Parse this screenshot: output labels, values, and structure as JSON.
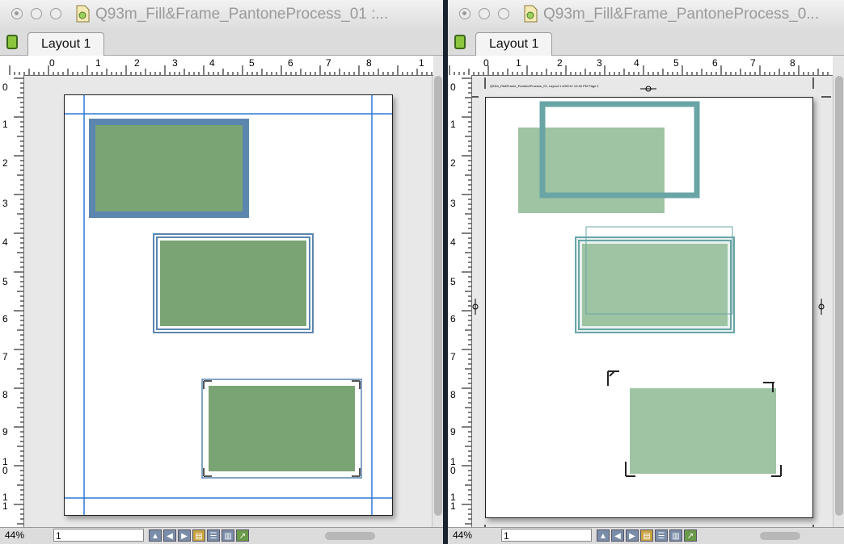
{
  "windows": {
    "left": {
      "title": "Q93m_Fill&Frame_PantoneProcess_01 :...",
      "tab_label": "Layout 1",
      "zoom": "44%",
      "page_number": "1"
    },
    "right": {
      "title": "Q93m_Fill&Frame_PantoneProcess_0...",
      "tab_label": "Layout 1",
      "zoom": "44%",
      "page_number": "1",
      "slug_text": "Q93m_Fill&Frame_PantoneProcess_01, Layout 1   6/02/12   12:46 PM   Page 1"
    }
  },
  "ruler": {
    "h_labels": [
      "0",
      "1",
      "2",
      "3",
      "4",
      "5",
      "6",
      "7",
      "8",
      "1"
    ],
    "v_labels": [
      "0",
      "1",
      "2",
      "3",
      "4",
      "5",
      "6",
      "7",
      "8",
      "9",
      "1\n0",
      "1\n1"
    ]
  },
  "colors": {
    "fill_green_left": "#7aa474",
    "frame_blue_left": "#5b86b0",
    "fill_green_right": "#9ec4a3",
    "frame_teal_right": "#6aa5a6",
    "guide_blue": "#2f79d6"
  },
  "icons": {
    "close": "circle-button-icon",
    "minimize": "circle-button-icon",
    "zoom": "circle-button-icon",
    "document": "qxp-document-icon",
    "layout": "layout-tab-icon"
  }
}
